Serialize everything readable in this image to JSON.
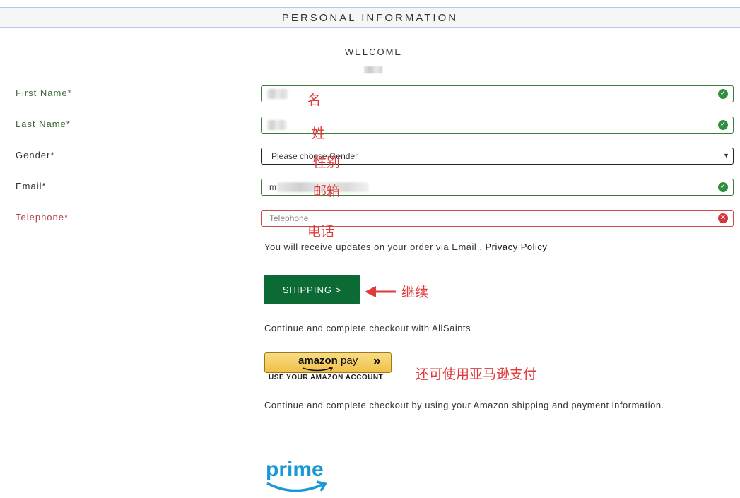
{
  "header": {
    "title": "PERSONAL INFORMATION"
  },
  "welcome": {
    "text": "WELCOME"
  },
  "form": {
    "first_name": {
      "label": "First Name*",
      "annotation": "名"
    },
    "last_name": {
      "label": "Last Name*",
      "annotation": "姓"
    },
    "gender": {
      "label": "Gender*",
      "selected": "Please choose Gender",
      "annotation": "性别"
    },
    "email": {
      "label": "Email*",
      "value_prefix": "m",
      "annotation": "邮箱"
    },
    "telephone": {
      "label": "Telephone*",
      "placeholder": "Telephone",
      "annotation": "电话"
    }
  },
  "notice": {
    "text": "You will receive updates on your order via Email .",
    "link": "Privacy Policy"
  },
  "shipping": {
    "button_label": "SHIPPING >",
    "annotation": "继续"
  },
  "continue_text": "Continue and complete checkout with AllSaints",
  "amazon": {
    "logo_word": "amazon",
    "logo_pay": "pay",
    "chevrons": "»",
    "subtext": "USE YOUR AMAZON ACCOUNT",
    "annotation": "还可使用亚马逊支付",
    "description": "Continue and complete checkout by using your Amazon shipping and payment information."
  },
  "prime": {
    "logo_text": "prime"
  },
  "colors": {
    "valid": "#2f8f3f",
    "error": "#d8343a",
    "button": "#0c6b35",
    "annotation": "#e03a3a",
    "prime": "#1a98d5"
  }
}
